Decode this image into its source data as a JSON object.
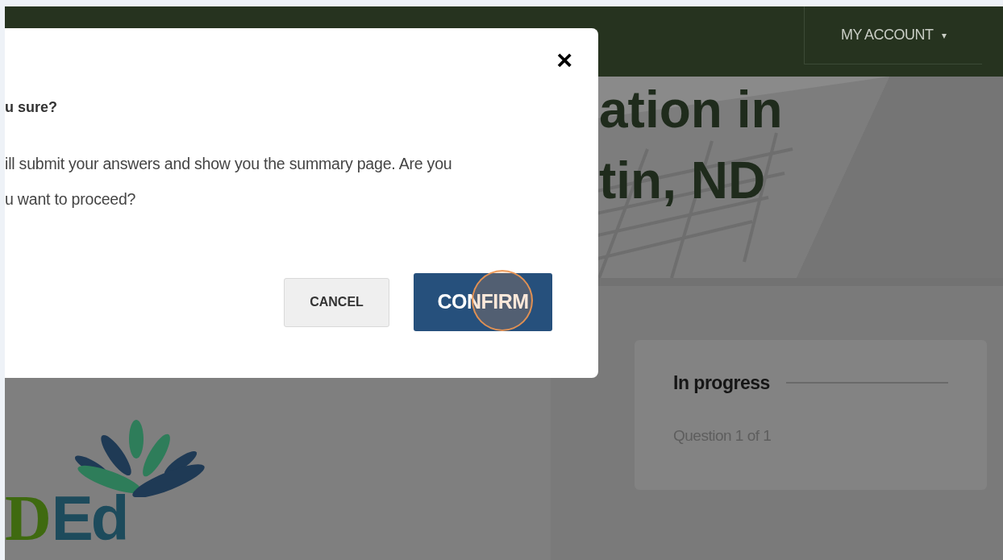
{
  "navbar": {
    "account_menu": {
      "label": "MY ACCOUNT",
      "caret": "▾"
    }
  },
  "hero": {
    "heading_lines": [
      "ation in",
      "tin, ND"
    ]
  },
  "logo": {
    "parts": [
      {
        "text": "D",
        "kind": "serif"
      },
      {
        "text": "Ed",
        "kind": "bold"
      }
    ]
  },
  "progress_card": {
    "title": "In progress",
    "subtitle": "Question 1 of 1"
  },
  "modal": {
    "close": "×",
    "title": "u sure?",
    "body_lines": [
      "ill submit your answers and show you the summary page. Are you",
      "u want to proceed?"
    ],
    "buttons": [
      {
        "label": "CANCEL",
        "kind": "secondary"
      },
      {
        "label": "CONFIRM",
        "kind": "primary"
      }
    ]
  }
}
